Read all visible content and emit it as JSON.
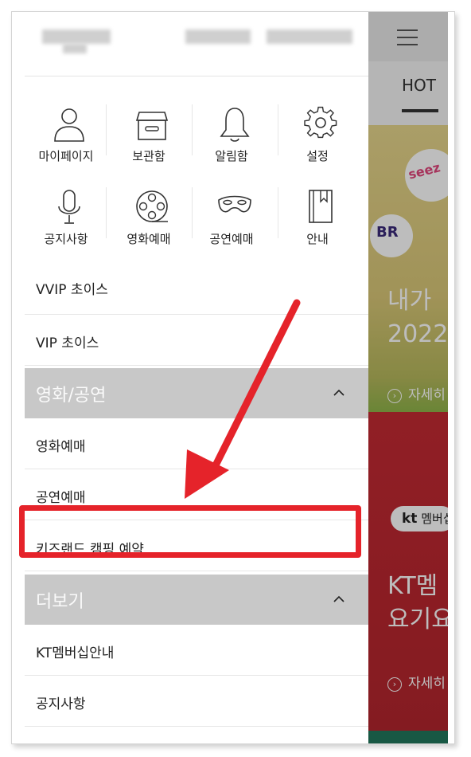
{
  "tabs": {
    "hot": "HOT"
  },
  "grid": [
    {
      "label": "마이페이지",
      "icon": "user-icon"
    },
    {
      "label": "보관함",
      "icon": "archive-box-icon"
    },
    {
      "label": "알림함",
      "icon": "bell-icon"
    },
    {
      "label": "설정",
      "icon": "gear-icon"
    },
    {
      "label": "공지사항",
      "icon": "microphone-icon"
    },
    {
      "label": "영화예매",
      "icon": "film-reel-icon"
    },
    {
      "label": "공연예매",
      "icon": "mask-icon"
    },
    {
      "label": "안내",
      "icon": "bookmark-book-icon"
    }
  ],
  "menu": {
    "vvip": "VVIP 초이스",
    "vip": "VIP 초이스",
    "section_movie": "영화/공연",
    "movie_booking": "영화예매",
    "show_booking": "공연예매",
    "kidsland": "키즈랜드 캠핑 예약",
    "section_more": "더보기",
    "kt_membership": "KT멤버십안내",
    "notice": "공지사항"
  },
  "banner1": {
    "brand": "seez",
    "logo": "BR",
    "headline_line1": "내가 ",
    "headline_line2": "2022",
    "detail": "자세히"
  },
  "banner2": {
    "logo": "kt",
    "logo_suffix": "멤버십",
    "headline_line1": "KT멤",
    "headline_line2": "요기요",
    "detail": "자세히"
  },
  "colors": {
    "accent": "#e5232a",
    "section_bg": "#c8c8c8",
    "banner_red": "#c42a33"
  }
}
